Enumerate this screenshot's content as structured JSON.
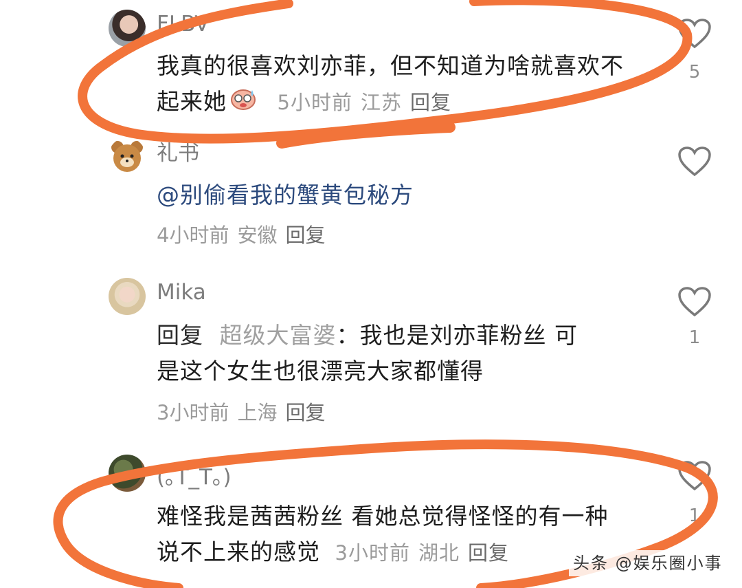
{
  "comments": [
    {
      "username": "FLBV",
      "text": "我真的很喜欢刘亦菲，但不知道为啥就喜欢不起来她",
      "emoji_icon": "sweating-face-emoji",
      "time": "5小时前",
      "location": "江苏",
      "reply_label": "回复",
      "likes": "5"
    },
    {
      "username": "礼书",
      "text": "@别偷看我的蟹黄包秘方",
      "time": "4小时前",
      "location": "安徽",
      "reply_label": "回复",
      "likes": ""
    },
    {
      "username": "Mika",
      "reply_prefix": "回复",
      "reply_target": "超级大富婆",
      "text_line1": "：我也是刘亦菲粉丝 可",
      "text_line2": "是这个女生也很漂亮大家都懂得",
      "time": "3小时前",
      "location": "上海",
      "reply_label": "回复",
      "likes": "1"
    },
    {
      "username": "(｡T_T｡)",
      "text": "难怪我是茜茜粉丝 看她总觉得怪怪的有一种说不上来的感觉",
      "time": "3小时前",
      "location": "湖北",
      "reply_label": "回复",
      "likes": "1"
    }
  ],
  "watermark": "头条 @娱乐圈小事",
  "colors": {
    "annotation_orange": "#f2743a",
    "mention_blue": "#2c4a7d",
    "meta_gray": "#9b9b9b"
  }
}
